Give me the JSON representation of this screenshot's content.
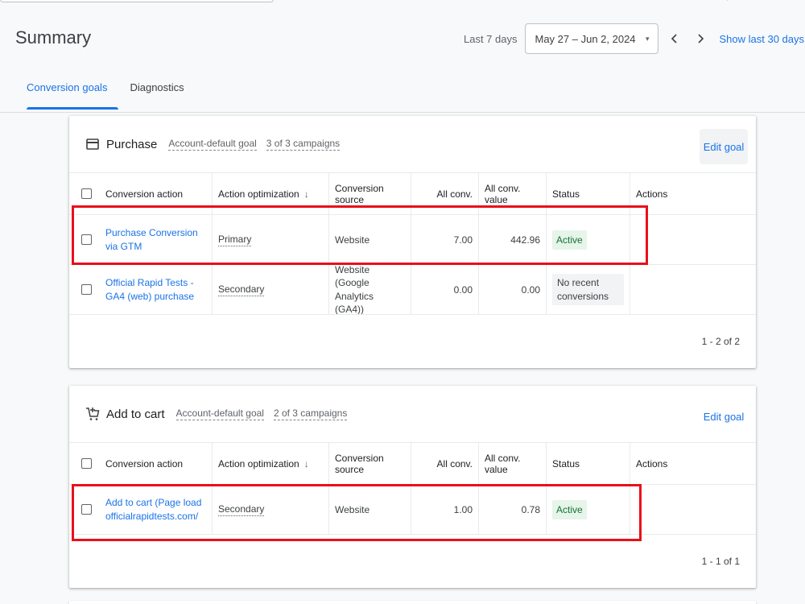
{
  "page": {
    "title": "Summary"
  },
  "date_range": {
    "label": "Last 7 days",
    "value": "May 27 – Jun 2, 2024",
    "caret": "▾",
    "prev": "‹",
    "next": "›",
    "show_last": "Show last 30 days"
  },
  "tabs": [
    {
      "label": "Conversion goals",
      "active": true
    },
    {
      "label": "Diagnostics",
      "active": false
    }
  ],
  "columns": {
    "action": "Conversion action",
    "optimization": "Action optimization",
    "sort": "↓",
    "source": "Conversion source",
    "all_conv": "All conv.",
    "all_conv_value": "All conv. value",
    "status": "Status",
    "actions": "Actions"
  },
  "goals": [
    {
      "icon": "credit-card-icon",
      "title": "Purchase",
      "goal_type": "Account-default goal",
      "campaigns": "3 of 3 campaigns",
      "edit_label": "Edit goal",
      "rows": [
        {
          "action": "Purchase Conversion via GTM",
          "optimization": "Primary",
          "source": "Website",
          "all_conv": "7.00",
          "all_conv_value": "442.96",
          "status": "Active"
        },
        {
          "action": "Official Rapid Tests - GA4 (web) purchase",
          "optimization": "Secondary",
          "source": "Website (Google Analytics (GA4))",
          "all_conv": "0.00",
          "all_conv_value": "0.00",
          "status": "No recent conversions"
        }
      ],
      "pagination": "1 - 2 of 2"
    },
    {
      "icon": "shopping-cart-add-icon",
      "title": "Add to cart",
      "goal_type": "Account-default goal",
      "campaigns": "2 of 3 campaigns",
      "edit_label": "Edit goal",
      "rows": [
        {
          "action": "Add to cart (Page load officialrapidtests.com/",
          "optimization": "Secondary",
          "source": "Website",
          "all_conv": "1.00",
          "all_conv_value": "0.78",
          "status": "Active"
        }
      ],
      "pagination": "1 - 1 of 1"
    }
  ],
  "colors": {
    "accent": "#1a73e8",
    "active_chip_bg": "#e6f4ea",
    "active_chip_text": "#137333",
    "highlight": "#e8101a"
  }
}
